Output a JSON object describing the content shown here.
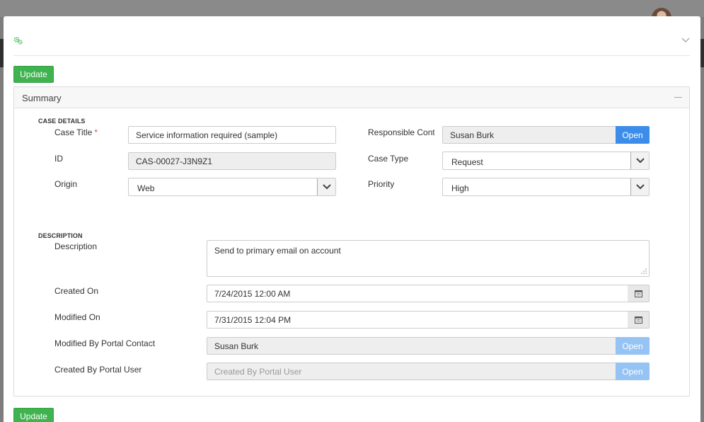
{
  "modal": {
    "update_label": "Update",
    "header_icon": "cogs-icon",
    "collapse_icon": "chevron-down-icon"
  },
  "summary": {
    "title": "Summary",
    "collapse_icon": "minus-icon"
  },
  "case_details": {
    "section_title": "CASE DETAILS",
    "case_title_label": "Case Title",
    "case_title_required": "*",
    "case_title_value": "Service information required (sample)",
    "id_label": "ID",
    "id_value": "CAS-00027-J3N9Z1",
    "origin_label": "Origin",
    "origin_value": "Web",
    "responsible_contact_label": "Responsible Contact",
    "responsible_contact_value": "Susan Burk",
    "open_label": "Open",
    "case_type_label": "Case Type",
    "case_type_value": "Request",
    "priority_label": "Priority",
    "priority_value": "High"
  },
  "description": {
    "section_title": "DESCRIPTION",
    "description_label": "Description",
    "description_value": "Send to primary email on account",
    "created_on_label": "Created On",
    "created_on_value": "7/24/2015 12:00 AM",
    "modified_on_label": "Modified On",
    "modified_on_value": "7/31/2015 12:04 PM",
    "modified_by_label": "Modified By Portal Contact",
    "modified_by_value": "Susan Burk",
    "created_by_label": "Created By Portal User",
    "created_by_placeholder": "Created By Portal User",
    "open_label": "Open"
  },
  "colors": {
    "update_button": "#3fb34f",
    "open_button": "#3c8dea",
    "open_button_disabled": "#95c3f3",
    "required_star": "#d9534f"
  }
}
